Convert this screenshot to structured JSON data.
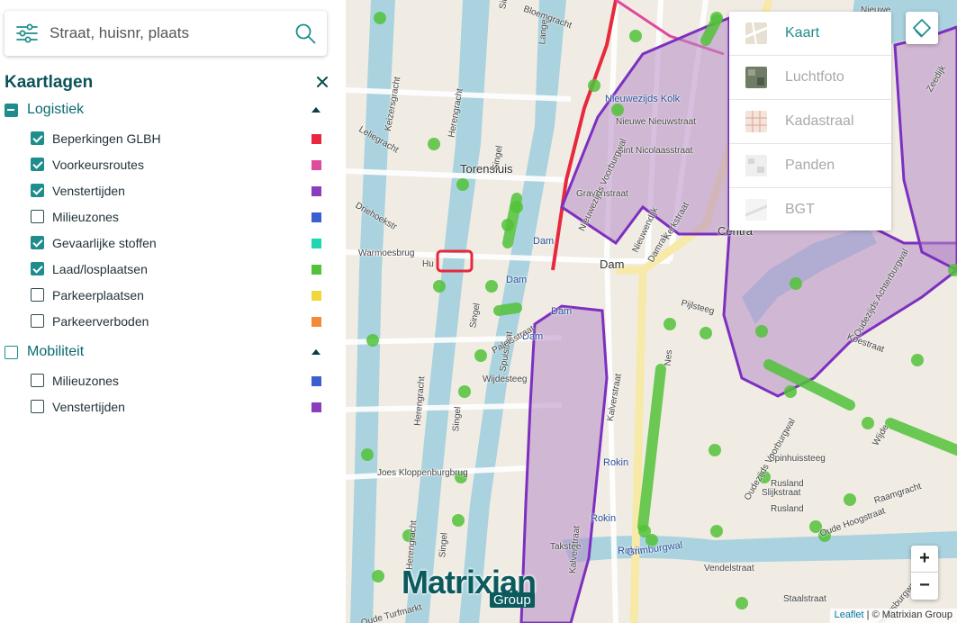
{
  "search": {
    "placeholder": "Straat, huisnr, plaats",
    "filter_icon": "sliders-icon",
    "search_icon": "magnifier-icon"
  },
  "layers_panel": {
    "title": "Kaartlagen",
    "close_icon": "close-icon",
    "groups": [
      {
        "label": "Logistiek",
        "state": "indeterminate",
        "expanded": true,
        "items": [
          {
            "label": "Beperkingen GLBH",
            "checked": true,
            "color": "#e8283c"
          },
          {
            "label": "Voorkeursroutes",
            "checked": true,
            "color": "#de4a9e"
          },
          {
            "label": "Venstertijden",
            "checked": true,
            "color": "#8a3dbd"
          },
          {
            "label": "Milieuzones",
            "checked": false,
            "color": "#3a5fd0"
          },
          {
            "label": "Gevaarlijke stoffen",
            "checked": true,
            "color": "#1fd6b0"
          },
          {
            "label": "Laad/losplaatsen",
            "checked": true,
            "color": "#52c23a"
          },
          {
            "label": "Parkeerplaatsen",
            "checked": false,
            "color": "#f0d83a"
          },
          {
            "label": "Parkeerverboden",
            "checked": false,
            "color": "#f5893a"
          }
        ]
      },
      {
        "label": "Mobiliteit",
        "state": "unchecked",
        "expanded": true,
        "items": [
          {
            "label": "Milieuzones",
            "checked": false,
            "color": "#3a5fd0"
          },
          {
            "label": "Venstertijden",
            "checked": false,
            "color": "#8a3dbd"
          }
        ]
      }
    ]
  },
  "basemap_menu": {
    "options": [
      {
        "label": "Kaart",
        "active": true
      },
      {
        "label": "Luchtfoto",
        "active": false
      },
      {
        "label": "Kadastraal",
        "active": false
      },
      {
        "label": "Panden",
        "active": false
      },
      {
        "label": "BGT",
        "active": false
      }
    ],
    "toggle_icon": "layers-icon"
  },
  "zoom": {
    "in": "+",
    "out": "−"
  },
  "attribution": {
    "link": "Leaflet",
    "rest": " | © Matrixian Group"
  },
  "logo": {
    "word": "Matrixian",
    "sub": "Group"
  },
  "map_labels": [
    "Torensluis",
    "Warmoesbrug",
    "Hu",
    "Dam",
    "Dam",
    "Dam",
    "Dam",
    "Dam",
    "Rokin",
    "Rokin",
    "Rokin",
    "Centra",
    "Nieuwezijds Kolk",
    "Nieuwe Nieuwstraat",
    "Sint Nicolaasstraat",
    "Gravenstraat",
    "Nieuwendijk",
    "Damrak",
    "Nieuwezijds Voorburgwal",
    "Singel",
    "Singel",
    "Singel",
    "Singel",
    "Singel",
    "Herengracht",
    "Herengracht",
    "Herengracht",
    "Keizersgracht",
    "Leliegracht",
    "Wijdesteeg",
    "Spuistraat",
    "Paleisstraat",
    "Kalverstraat",
    "Kalverstraat",
    "Takstee",
    "Grimburgwal",
    "Spinhuissteeg",
    "Rusland",
    "Slijkstraat",
    "Kloveniersburgwal",
    "Oudezijds Voorburgwal",
    "Oudezijds Achterburgwal",
    "Koestraat",
    "Raamgracht",
    "Staalstraat",
    "Vendelstraat",
    "Joes Kloppenburgbrug",
    "Pijlsteeg",
    "Oude Turfmarkt",
    "Zeedijk",
    "Nieuwe",
    "Bloemgracht",
    "Lange",
    "Kerkstraat",
    "Driehoekstr",
    "Oude Hoogstraat",
    "Rusland",
    "Nes",
    "Wijde"
  ]
}
